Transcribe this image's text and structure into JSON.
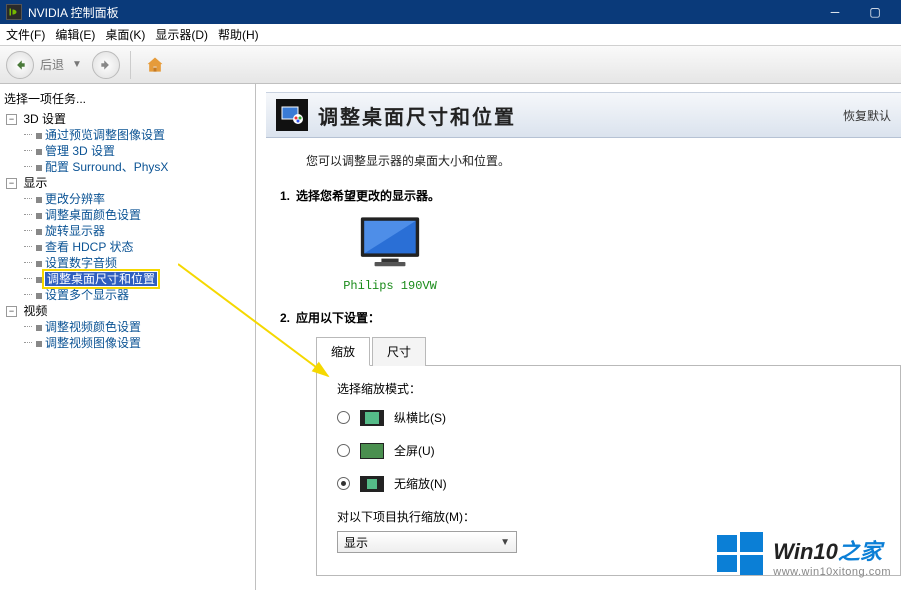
{
  "titlebar": {
    "title": "NVIDIA 控制面板"
  },
  "menu": {
    "file": "文件(F)",
    "edit": "编辑(E)",
    "desktop": "桌面(K)",
    "display": "显示器(D)",
    "help": "帮助(H)"
  },
  "toolbar": {
    "back": "后退"
  },
  "sidebar": {
    "heading": "选择一项任务...",
    "cat3d": "3D 设置",
    "cat3d_items": [
      "通过预览调整图像设置",
      "管理 3D 设置",
      "配置 Surround、PhysX"
    ],
    "catDisplay": "显示",
    "catDisplay_items": [
      "更改分辨率",
      "调整桌面颜色设置",
      "旋转显示器",
      "查看 HDCP 状态",
      "设置数字音频",
      "调整桌面尺寸和位置",
      "设置多个显示器"
    ],
    "catVideo": "视频",
    "catVideo_items": [
      "调整视频颜色设置",
      "调整视频图像设置"
    ]
  },
  "banner": {
    "title": "调整桌面尺寸和位置",
    "restore": "恢复默认"
  },
  "desc": "您可以调整显示器的桌面大小和位置。",
  "step1": {
    "num": "1.",
    "title": "选择您希望更改的显示器。",
    "monitorLabel": "Philips 190VW"
  },
  "step2": {
    "num": "2.",
    "title": "应用以下设置："
  },
  "tabs": {
    "scale": "缩放",
    "size": "尺寸"
  },
  "scale": {
    "modeLabel": "选择缩放模式：",
    "aspect": "纵横比(S)",
    "full": "全屏(U)",
    "none": "无缩放(N)",
    "performLabel": "对以下项目执行缩放(M)：",
    "combo": "显示"
  },
  "watermark": {
    "brand": "Win10",
    "zhi": "之家",
    "url": "www.win10xitong.com"
  }
}
